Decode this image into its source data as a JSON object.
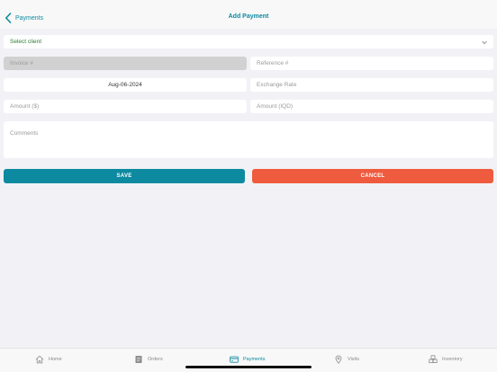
{
  "nav": {
    "back_label": "Payments",
    "title": "Add Payment"
  },
  "form": {
    "client_select": "Select client",
    "invoice_placeholder": "Invoice #",
    "reference_placeholder": "Reference #",
    "date_value": "Aug-06-2024",
    "exchange_rate_placeholder": "Exchange Rate",
    "amount_usd_placeholder": "Amount ($)",
    "amount_iqd_placeholder": "Amount (IQD)",
    "comments_placeholder": "Comments"
  },
  "actions": {
    "save_label": "SAVE",
    "cancel_label": "CANCEL"
  },
  "tabs": [
    {
      "label": "Home",
      "icon": "home-icon"
    },
    {
      "label": "Orders",
      "icon": "orders-icon"
    },
    {
      "label": "Payments",
      "icon": "payments-icon",
      "active": true
    },
    {
      "label": "Visits",
      "icon": "location-pin-icon"
    },
    {
      "label": "Inventory",
      "icon": "inventory-icon"
    }
  ],
  "colors": {
    "accent": "#0e8aa0",
    "save": "#0e8aa0",
    "cancel": "#ef5b3e",
    "select_text": "#2e7d32"
  }
}
